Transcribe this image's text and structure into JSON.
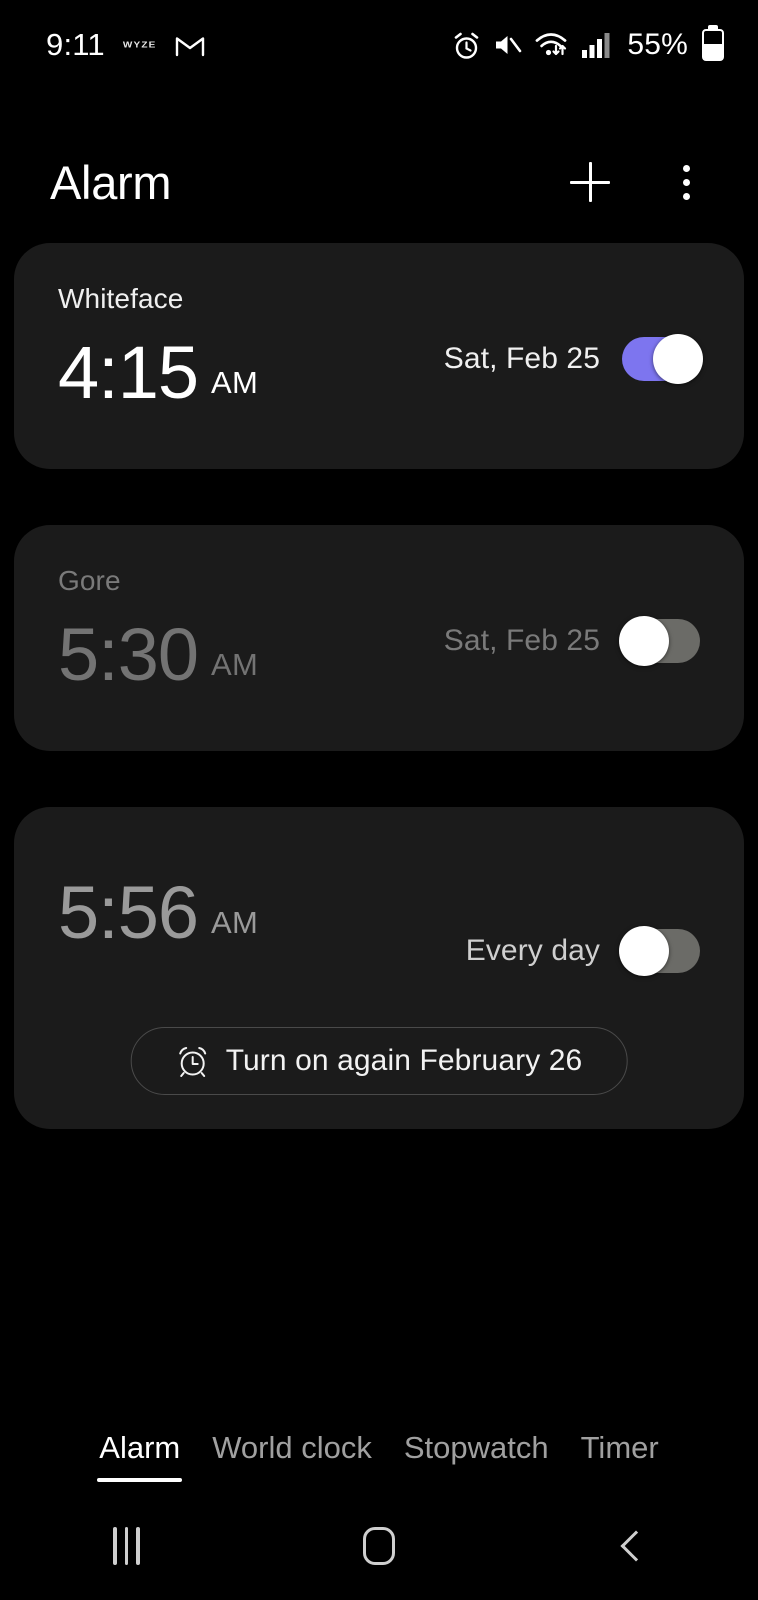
{
  "status_bar": {
    "time": "9:11",
    "left_icons": [
      {
        "name": "wyze-logo-icon",
        "label": "WYZE"
      },
      {
        "name": "gmail-icon",
        "label": "M"
      }
    ],
    "right_icons": [
      {
        "name": "alarm-set-icon"
      },
      {
        "name": "sound-muted-icon"
      },
      {
        "name": "wifi-icon"
      },
      {
        "name": "cellular-signal-icon"
      }
    ],
    "battery_percent_label": "55%",
    "battery_level": 55
  },
  "header": {
    "title": "Alarm",
    "add_label": "+",
    "more_label": "More options"
  },
  "alarms": [
    {
      "name": "Whiteface",
      "time": "4:15",
      "meridiem": "AM",
      "days": "Sat, Feb 25",
      "enabled": true
    },
    {
      "name": "Gore",
      "time": "5:30",
      "meridiem": "AM",
      "days": "Sat, Feb 25",
      "enabled": false
    },
    {
      "name": "",
      "time": "5:56",
      "meridiem": "AM",
      "days": "Every day",
      "enabled": false,
      "turn_on_again_label": "Turn on again February 26"
    }
  ],
  "tabs": [
    {
      "label": "Alarm",
      "active": true
    },
    {
      "label": "World clock",
      "active": false
    },
    {
      "label": "Stopwatch",
      "active": false
    },
    {
      "label": "Timer",
      "active": false
    }
  ],
  "nav_bar": {
    "recents_label": "Recents",
    "home_label": "Home",
    "back_label": "Back"
  },
  "colors": {
    "background": "#000000",
    "card": "#1b1b1b",
    "toggle_on": "#7d75ef",
    "toggle_off": "#6b6b67",
    "text_primary": "#ffffff",
    "text_disabled": "#7a7a7a"
  }
}
